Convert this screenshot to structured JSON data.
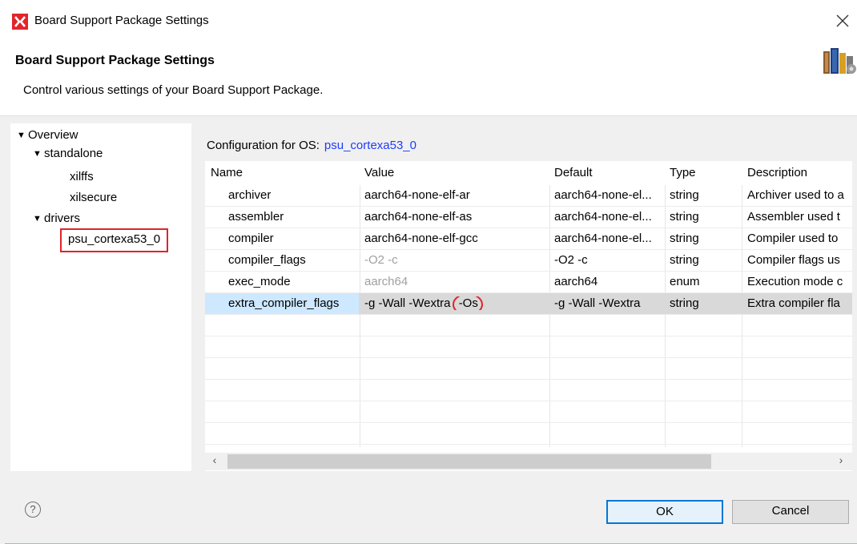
{
  "window": {
    "title": "Board Support Package Settings",
    "close_glyph": "✕"
  },
  "header": {
    "title": "Board Support Package Settings",
    "description": "Control various settings of your Board Support Package."
  },
  "tree": {
    "items": [
      {
        "label": "Overview",
        "expanded": true
      },
      {
        "label": "standalone",
        "expanded": true
      },
      {
        "label": "xilffs"
      },
      {
        "label": "xilsecure"
      },
      {
        "label": "drivers",
        "expanded": true
      },
      {
        "label": "psu_cortexa53_0",
        "selected": true
      }
    ]
  },
  "config": {
    "label": "Configuration for OS:",
    "os": "psu_cortexa53_0"
  },
  "table": {
    "columns": [
      "Name",
      "Value",
      "Default",
      "Type",
      "Description"
    ],
    "rows": [
      {
        "name": "archiver",
        "value": "aarch64-none-elf-ar",
        "default": "aarch64-none-el...",
        "type": "string",
        "description": "Archiver used to a"
      },
      {
        "name": "assembler",
        "value": "aarch64-none-elf-as",
        "default": "aarch64-none-el...",
        "type": "string",
        "description": "Assembler used t"
      },
      {
        "name": "compiler",
        "value": "aarch64-none-elf-gcc",
        "default": "aarch64-none-el...",
        "type": "string",
        "description": "Compiler used to"
      },
      {
        "name": "compiler_flags",
        "value": "-O2 -c",
        "default": "-O2 -c",
        "type": "string",
        "description": "Compiler flags us"
      },
      {
        "name": "exec_mode",
        "value": "aarch64",
        "default": "aarch64",
        "type": "enum",
        "description": "Execution mode c"
      },
      {
        "name": "extra_compiler_flags",
        "value": "-g -Wall -Wextra -Os",
        "value_main": "-g -Wall -Wextra",
        "value_highlight": "-Os",
        "default": "-g -Wall -Wextra",
        "type": "string",
        "description": "Extra compiler fla"
      }
    ]
  },
  "scroll": {
    "left": "‹",
    "right": "›"
  },
  "footer": {
    "help": "?",
    "ok_label": "OK",
    "cancel_label": "Cancel"
  },
  "colors": {
    "accent_red": "#e0242a",
    "link_blue": "#1e3cff",
    "ok_border": "#0078d7"
  }
}
